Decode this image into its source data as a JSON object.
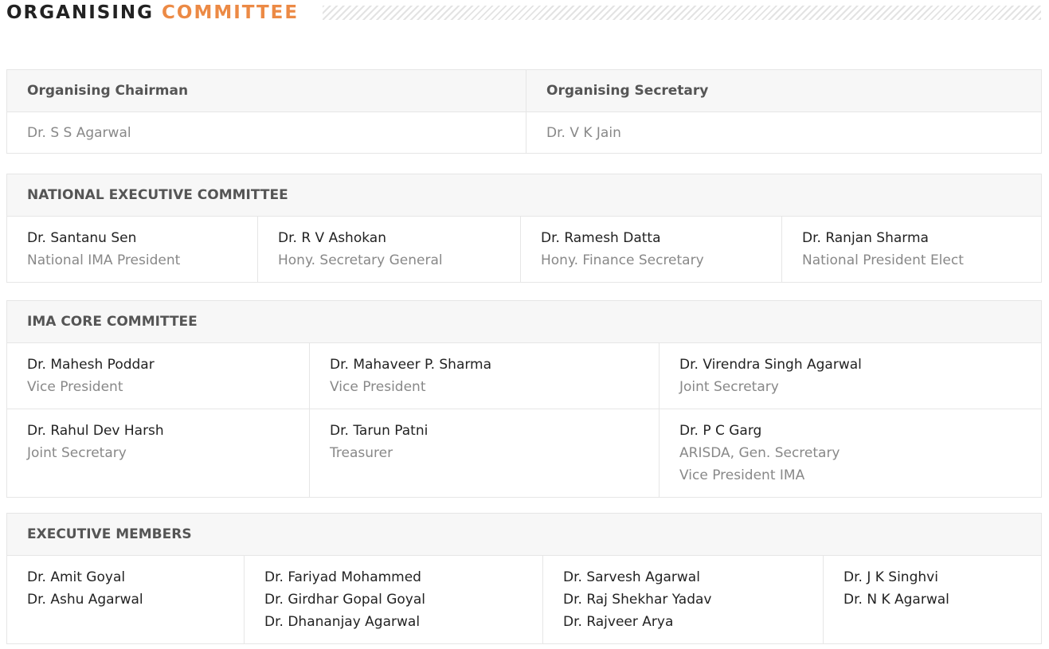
{
  "heading": {
    "part1": "ORGANISING",
    "part2": "COMMITTEE"
  },
  "organising": {
    "chairman_label": "Organising Chairman",
    "chairman_name": "Dr. S S Agarwal",
    "secretary_label": "Organising Secretary",
    "secretary_name": "Dr. V K Jain"
  },
  "national": {
    "title": "NATIONAL EXECUTIVE COMMITTEE",
    "members": [
      {
        "name": "Dr. Santanu Sen",
        "role": "National IMA President"
      },
      {
        "name": "Dr. R V Ashokan",
        "role": "Hony. Secretary General"
      },
      {
        "name": "Dr. Ramesh Datta",
        "role": "Hony. Finance Secretary"
      },
      {
        "name": "Dr. Ranjan Sharma",
        "role": "National President Elect"
      }
    ]
  },
  "core": {
    "title": "IMA CORE COMMITTEE",
    "members": [
      {
        "name": "Dr. Mahesh Poddar",
        "role": "Vice President"
      },
      {
        "name": "Dr. Mahaveer P. Sharma",
        "role": "Vice President"
      },
      {
        "name": "Dr. Virendra Singh Agarwal",
        "role": "Joint Secretary"
      },
      {
        "name": "Dr. Rahul Dev Harsh",
        "role": "Joint Secretary"
      },
      {
        "name": "Dr. Tarun Patni",
        "role": "Treasurer"
      },
      {
        "name": "Dr. P C Garg",
        "role": "ARISDA, Gen. Secretary",
        "role2": "Vice President IMA"
      }
    ]
  },
  "executive": {
    "title": "EXECUTIVE MEMBERS",
    "columns": [
      [
        "Dr. Amit Goyal",
        "Dr. Ashu Agarwal"
      ],
      [
        "Dr. Fariyad Mohammed",
        "Dr. Girdhar Gopal Goyal",
        "Dr. Dhananjay Agarwal"
      ],
      [
        "Dr. Sarvesh Agarwal",
        "Dr. Raj Shekhar Yadav",
        "Dr. Rajveer Arya"
      ],
      [
        "Dr. J K Singhvi",
        "Dr. N K Agarwal"
      ]
    ]
  },
  "colors": {
    "accent": "#ec8a45",
    "header_bg": "#f7f7f7",
    "border": "#e6e6e6"
  }
}
